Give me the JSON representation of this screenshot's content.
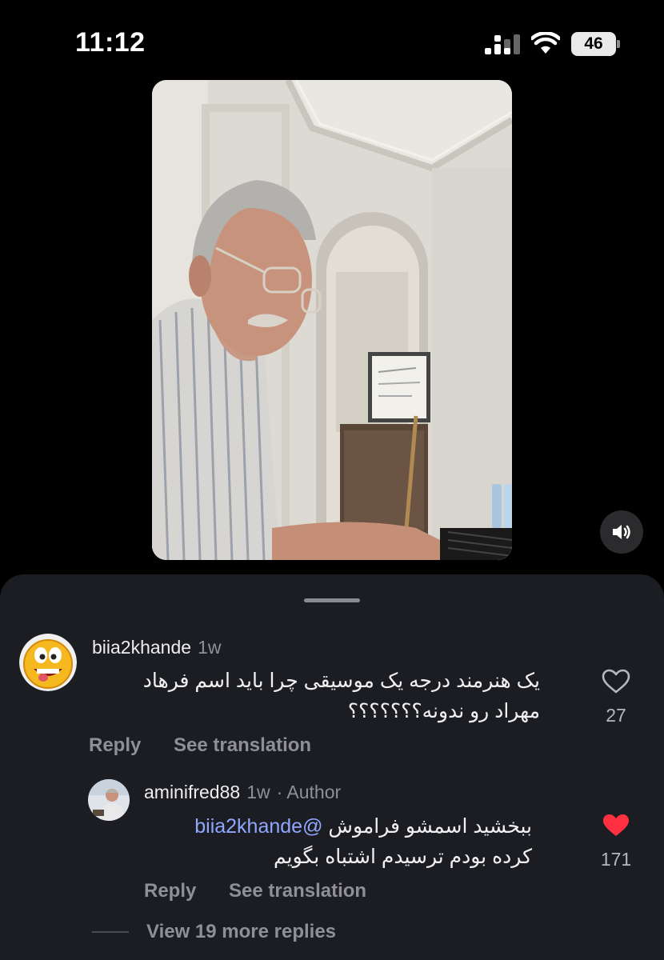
{
  "status_bar": {
    "time": "11:12",
    "battery": "46"
  },
  "comments": [
    {
      "username": "biia2khande",
      "time": "1w",
      "author_tag": "",
      "text_line1": "یک هنرمند درجه یک موسیقی چرا باید اسم فرهاد",
      "text_line2": "مهراد رو ندونه؟؟؟؟؟؟؟",
      "likes": "27",
      "liked": false,
      "reply_label": "Reply",
      "translate_label": "See translation"
    },
    {
      "username": "aminifred88",
      "time": "1w",
      "author_tag": "· Author",
      "mention": "@biia2khande",
      "text_line1": "ببخشید اسمشو فراموش",
      "text_line2": "کرده بودم ترسیدم اشتباه بگویم",
      "likes": "171",
      "liked": true,
      "reply_label": "Reply",
      "translate_label": "See translation"
    }
  ],
  "more_replies_label": "View 19 more replies",
  "colors": {
    "sheet_bg": "#1c1d22",
    "mention": "#8fa7ff",
    "like_active": "#ff3040",
    "muted_text": "#8e9096"
  },
  "icons": [
    "signal-icon",
    "wifi-icon",
    "speaker-icon",
    "heart-outline-icon",
    "heart-filled-icon"
  ]
}
